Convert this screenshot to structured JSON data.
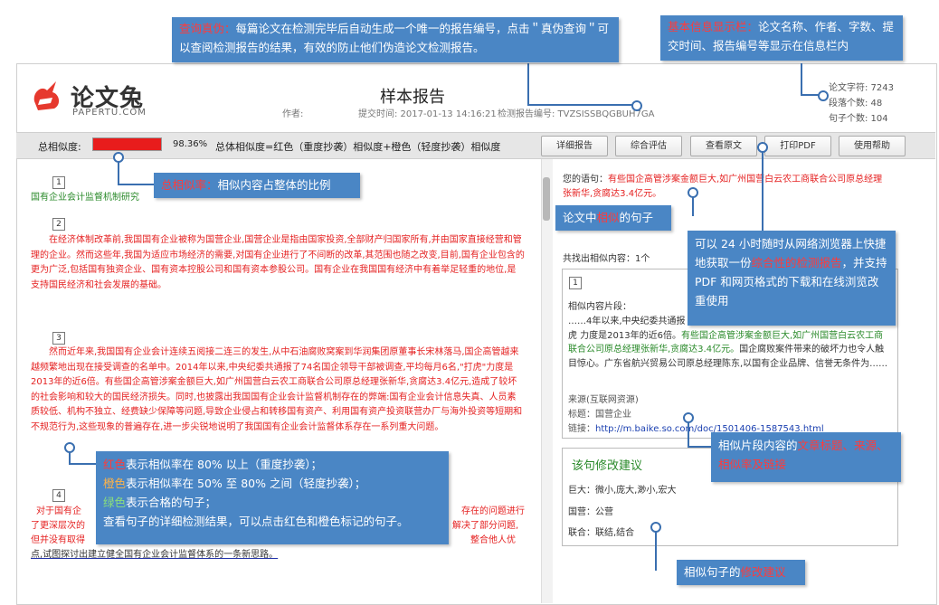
{
  "logo": {
    "name": "论文兔",
    "sub": "PAPERTU.COM"
  },
  "report": {
    "title": "样本报告",
    "author_label": "作者:",
    "submit_time": "提交时间: 2017-01-13 14:16:21",
    "report_no": "检测报告编号: TVZSISSBQGBUH7GA",
    "chars": "论文字符: 7243",
    "paragraphs": "段落个数: 48",
    "sentences": "句子个数: 104"
  },
  "toolbar": {
    "sim_label": "总相似度:",
    "sim_value": 0.9836,
    "sim_pct": "98.36%",
    "formula": "总体相似度=红色（重度抄袭）相似度+橙色（轻度抄袭）相似度",
    "buttons": [
      "详细报告",
      "综合评估",
      "查看原文",
      "打印PDF",
      "使用帮助"
    ]
  },
  "left": {
    "p1_no": "1",
    "p1_title": "国有企业会计监督机制研究",
    "p2_no": "2",
    "p2_red": "在经济体制改革前,我国国有企业被称为国营企业,国营企业是指由国家投资,全部财产归国家所有,并由国家直接经营和管理的企业。然而这些年,我国为适应市场经济的需要,对国有企业进行了不间断的改革,其范围也随之改变,目前,国有企业包含的更为广泛,包括国有独资企业、国有资本控股公司和国有资本参股公司。国有企业在我国国有经济中有着举足轻重的地位,是支持国民经济和社会发展的基础。",
    "p3_no": "3",
    "p3_red": "然而近年来,我国国有企业会计连续五阅接二连三的发生,从中石油腐败窝案到华润集团原董事长宋林落马,国企高管越来越频繁地出现在接受调查的名单中。2014年以来,中央纪委共通报了74名国企领导干部被调查,平均每月6名,\"打虎\"力度是2013年的近6倍。有些国企高管涉案金额巨大,如广州国营白云农工商联合公司原总经理张新华,贪腐达3.4亿元,造成了较坏的社会影响和较大的国民经济损失。同时,也披露出我国国有企业会计监督机制存在的弊端:国有企业会计信息失真、人员素质较低、机构不独立、经费缺少保障等问题,导致企业侵占和转移国有资产、利用国有资产投资联营办厂与海外投资等短期和不规范行为,这些现象的普遍存在,进一步尖锐地说明了我国国有企业会计监督体系存在一系列重大问题。",
    "p4_no": "4",
    "p4_head": "对于国有企",
    "p4_tail1": "存在的问题进行",
    "p4_line2a": "了更深层次的",
    "p4_line2b": "解决了部分问题,",
    "p4_line3a": "但并没有取得",
    "p4_line3b": "整合他人优",
    "p4_line4": "点,试图探讨出建立健全国有企业会计监督体系的一条新思路。"
  },
  "right": {
    "your_sentence_label": "您的语句：",
    "your_sentence": "有些国企高管涉案金额巨大,如广州国营白云农工商联合公司原总经理张新华,贪腐达3.4亿元。",
    "found_count": "共找出相似内容：1个",
    "frag_no": "1",
    "frag_label": "相似内容片段：",
    "frag_a": "……4年以来,中央纪委共通报",
    "frag_b": "虎 力度是2013年的近6倍。",
    "frag_green": "有些国企高管涉案金额巨大,如广州国营白云农工商联合公司原总经理张新华,贪腐达3.4亿元。",
    "frag_c": "国企腐败案件带来的破坏力也令人触目惊心。广东省航兴贸易公司原总经理陈东,以国有企业品牌、信誉无条件为……",
    "source_label": "来源(互联网资源)",
    "source_title": "标题：国营企业",
    "source_link_label": "链接：",
    "source_link": "http://m.baike.so.com/doc/1501406-1587543.html",
    "sugg_title": "该句修改建议",
    "sugg1": "巨大：微小,庞大,渺小,宏大",
    "sugg2": "国营：公营",
    "sugg3": "联合：联结,结合"
  },
  "callouts": {
    "c1_hl": "查询真伪：",
    "c1_text": "每篇论文在检测完毕后自动生成一个唯一的报告编号，点击＂真伪查询＂可以查阅检测报告的结果，有效的防止他们伪造论文检测报告。",
    "c2_hl": "基本信息显示栏：",
    "c2_text": "论文名称、作者、字数、提交时间、报告编号等显示在信息栏内",
    "c3_hl": "总相似率：",
    "c3_text": "相似内容占整体的比例",
    "c4_a": "论文中",
    "c4_hl": "相似",
    "c4_b": "的句子",
    "c5_a": "可以 24 小时随时从网络浏览器上快捷地获取一份",
    "c5_hl": "综合性的检测报告",
    "c5_b": "，并支持 PDF 和网页格式的下载和在线浏览改重使用",
    "c6_a": "相似片段内容的",
    "c6_hl": "文章标题、来源、相似率及链接",
    "c7_red": "红色",
    "c7_l1": "表示相似率在 80% 以上（重度抄袭）；",
    "c7_orange": "橙色",
    "c7_l2": "表示相似率在 50% 至 80% 之间（轻度抄袭）；",
    "c7_green": "绿色",
    "c7_l3": "表示合格的句子；",
    "c7_l4": "查看句子的详细检测结果，可以点击红色和橙色标记的句子。",
    "c8_a": "相似句子的",
    "c8_hl": "修改建议"
  }
}
